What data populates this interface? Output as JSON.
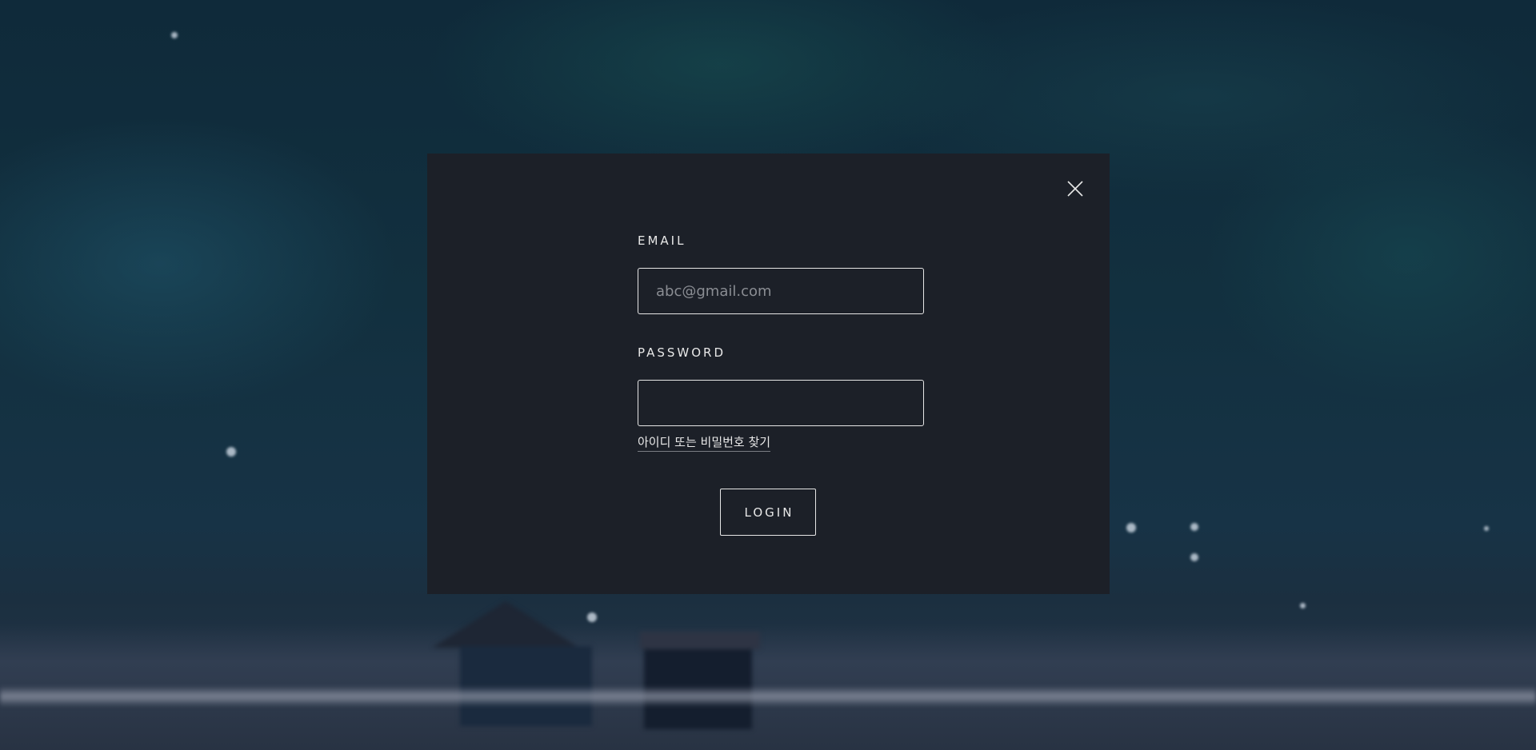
{
  "login_modal": {
    "email_label": "EMAIL",
    "email_placeholder": "abc@gmail.com",
    "email_value": "",
    "password_label": "PASSWORD",
    "password_value": "",
    "find_account_link": "아이디 또는 비밀번호 찾기",
    "login_button": "LOGIN",
    "close_icon": "close-icon"
  }
}
